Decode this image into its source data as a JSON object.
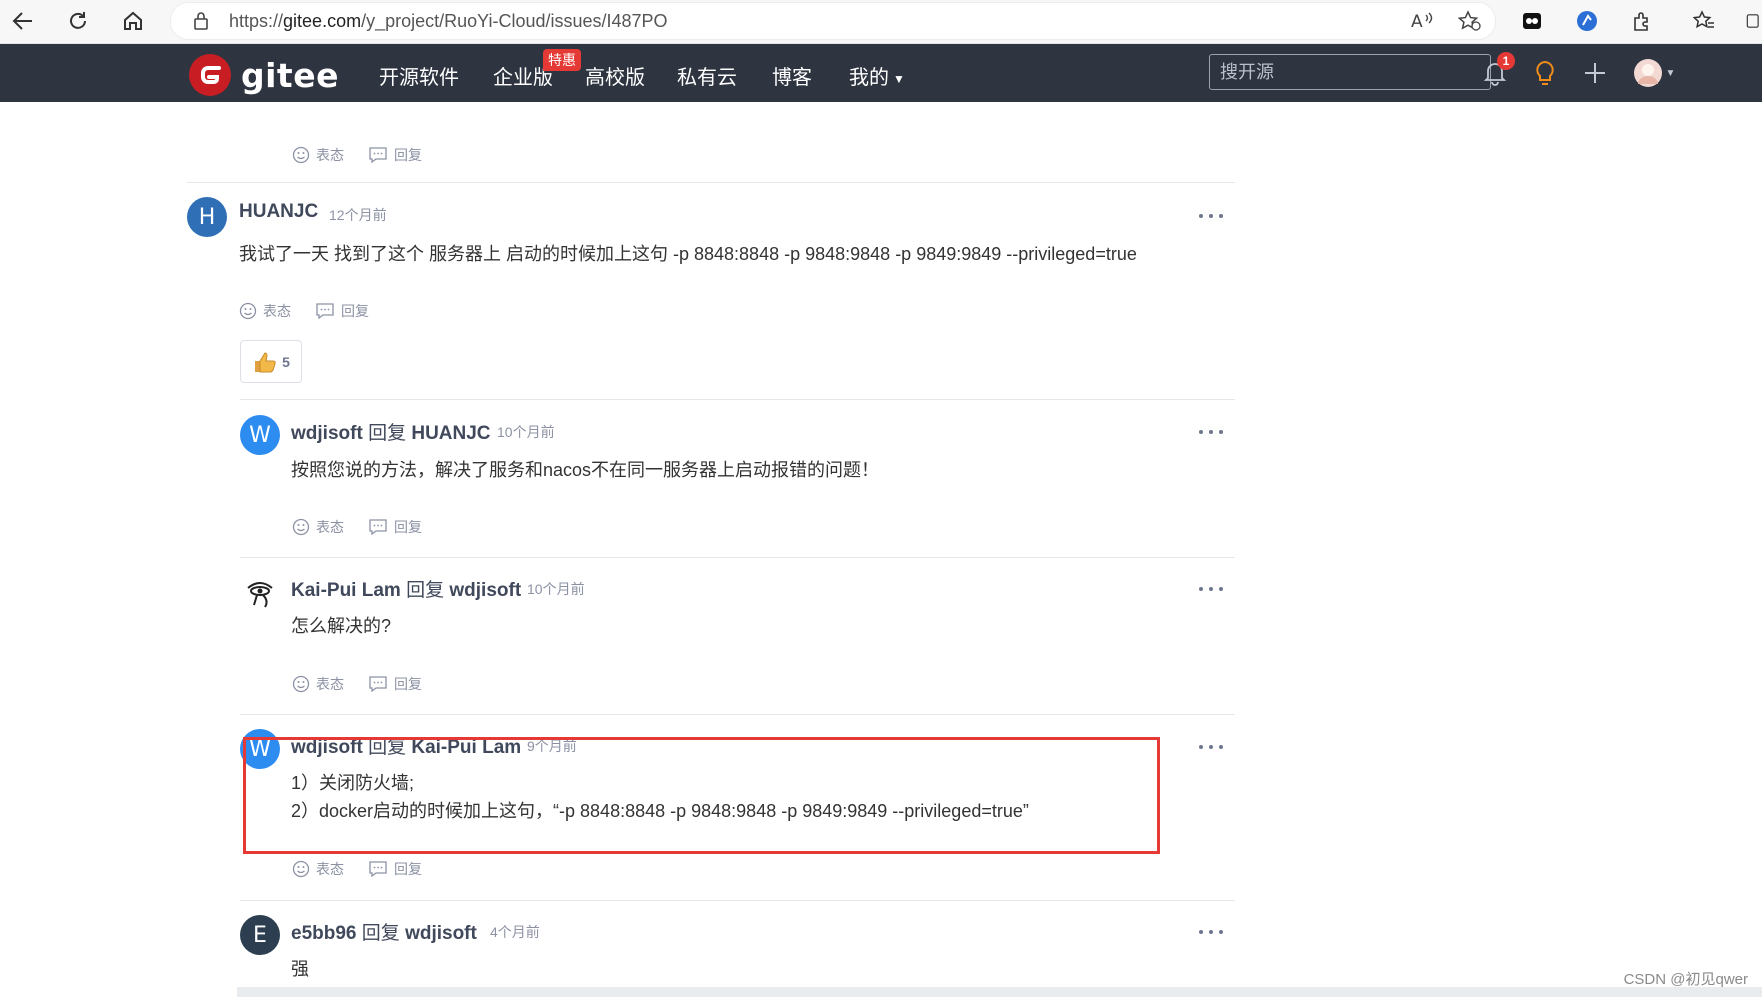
{
  "browser": {
    "url_prefix": "https://",
    "url_domain": "gitee.com",
    "url_path": "/y_project/RuoYi-Cloud/issues/I487PO"
  },
  "header": {
    "logo_text": "gitee",
    "nav": [
      "开源软件",
      "企业版",
      "高校版",
      "私有云",
      "博客",
      "我的"
    ],
    "special_badge": "特惠",
    "search_placeholder": "搜开源",
    "notification_count": "1"
  },
  "actions": {
    "react_label": "表态",
    "reply_label": "回复"
  },
  "comments": [
    {
      "avatar_letter": "H",
      "avatar_color": "#2f6fb5",
      "author": "HUANJC",
      "time": "12个月前",
      "lines": [
        "我试了一天 找到了这个 服务器上 启动的时候加上这句 -p 8848:8848 -p 9848:9848 -p 9849:9849 --privileged=true"
      ],
      "likes": "5"
    },
    {
      "avatar_letter": "W",
      "avatar_color": "#2d8cf0",
      "author": "wdjisoft",
      "reply_word": "回复",
      "reply_to": "HUANJC",
      "time": "10个月前",
      "lines": [
        "按照您说的方法，解决了服务和nacos不在同一服务器上启动报错的问题！"
      ]
    },
    {
      "avatar_letter": "",
      "avatar_color": "#ffffff",
      "author": "Kai-Pui Lam",
      "reply_word": "回复",
      "reply_to": "wdjisoft",
      "time": "10个月前",
      "lines": [
        "怎么解决的?"
      ]
    },
    {
      "avatar_letter": "W",
      "avatar_color": "#2d8cf0",
      "author": "wdjisoft",
      "reply_word": "回复",
      "reply_to": "Kai-Pui Lam",
      "time": "9个月前",
      "lines": [
        "1）关闭防火墙;",
        "2）docker启动的时候加上这句，“-p 8848:8848 -p 9848:9848 -p 9849:9849 --privileged=true”"
      ]
    },
    {
      "avatar_letter": "E",
      "avatar_color": "#2c3e50",
      "author": "e5bb96",
      "reply_word": "回复",
      "reply_to": "wdjisoft",
      "time": "4个月前",
      "lines": [
        "强"
      ]
    }
  ],
  "watermark": "CSDN @初见qwer"
}
